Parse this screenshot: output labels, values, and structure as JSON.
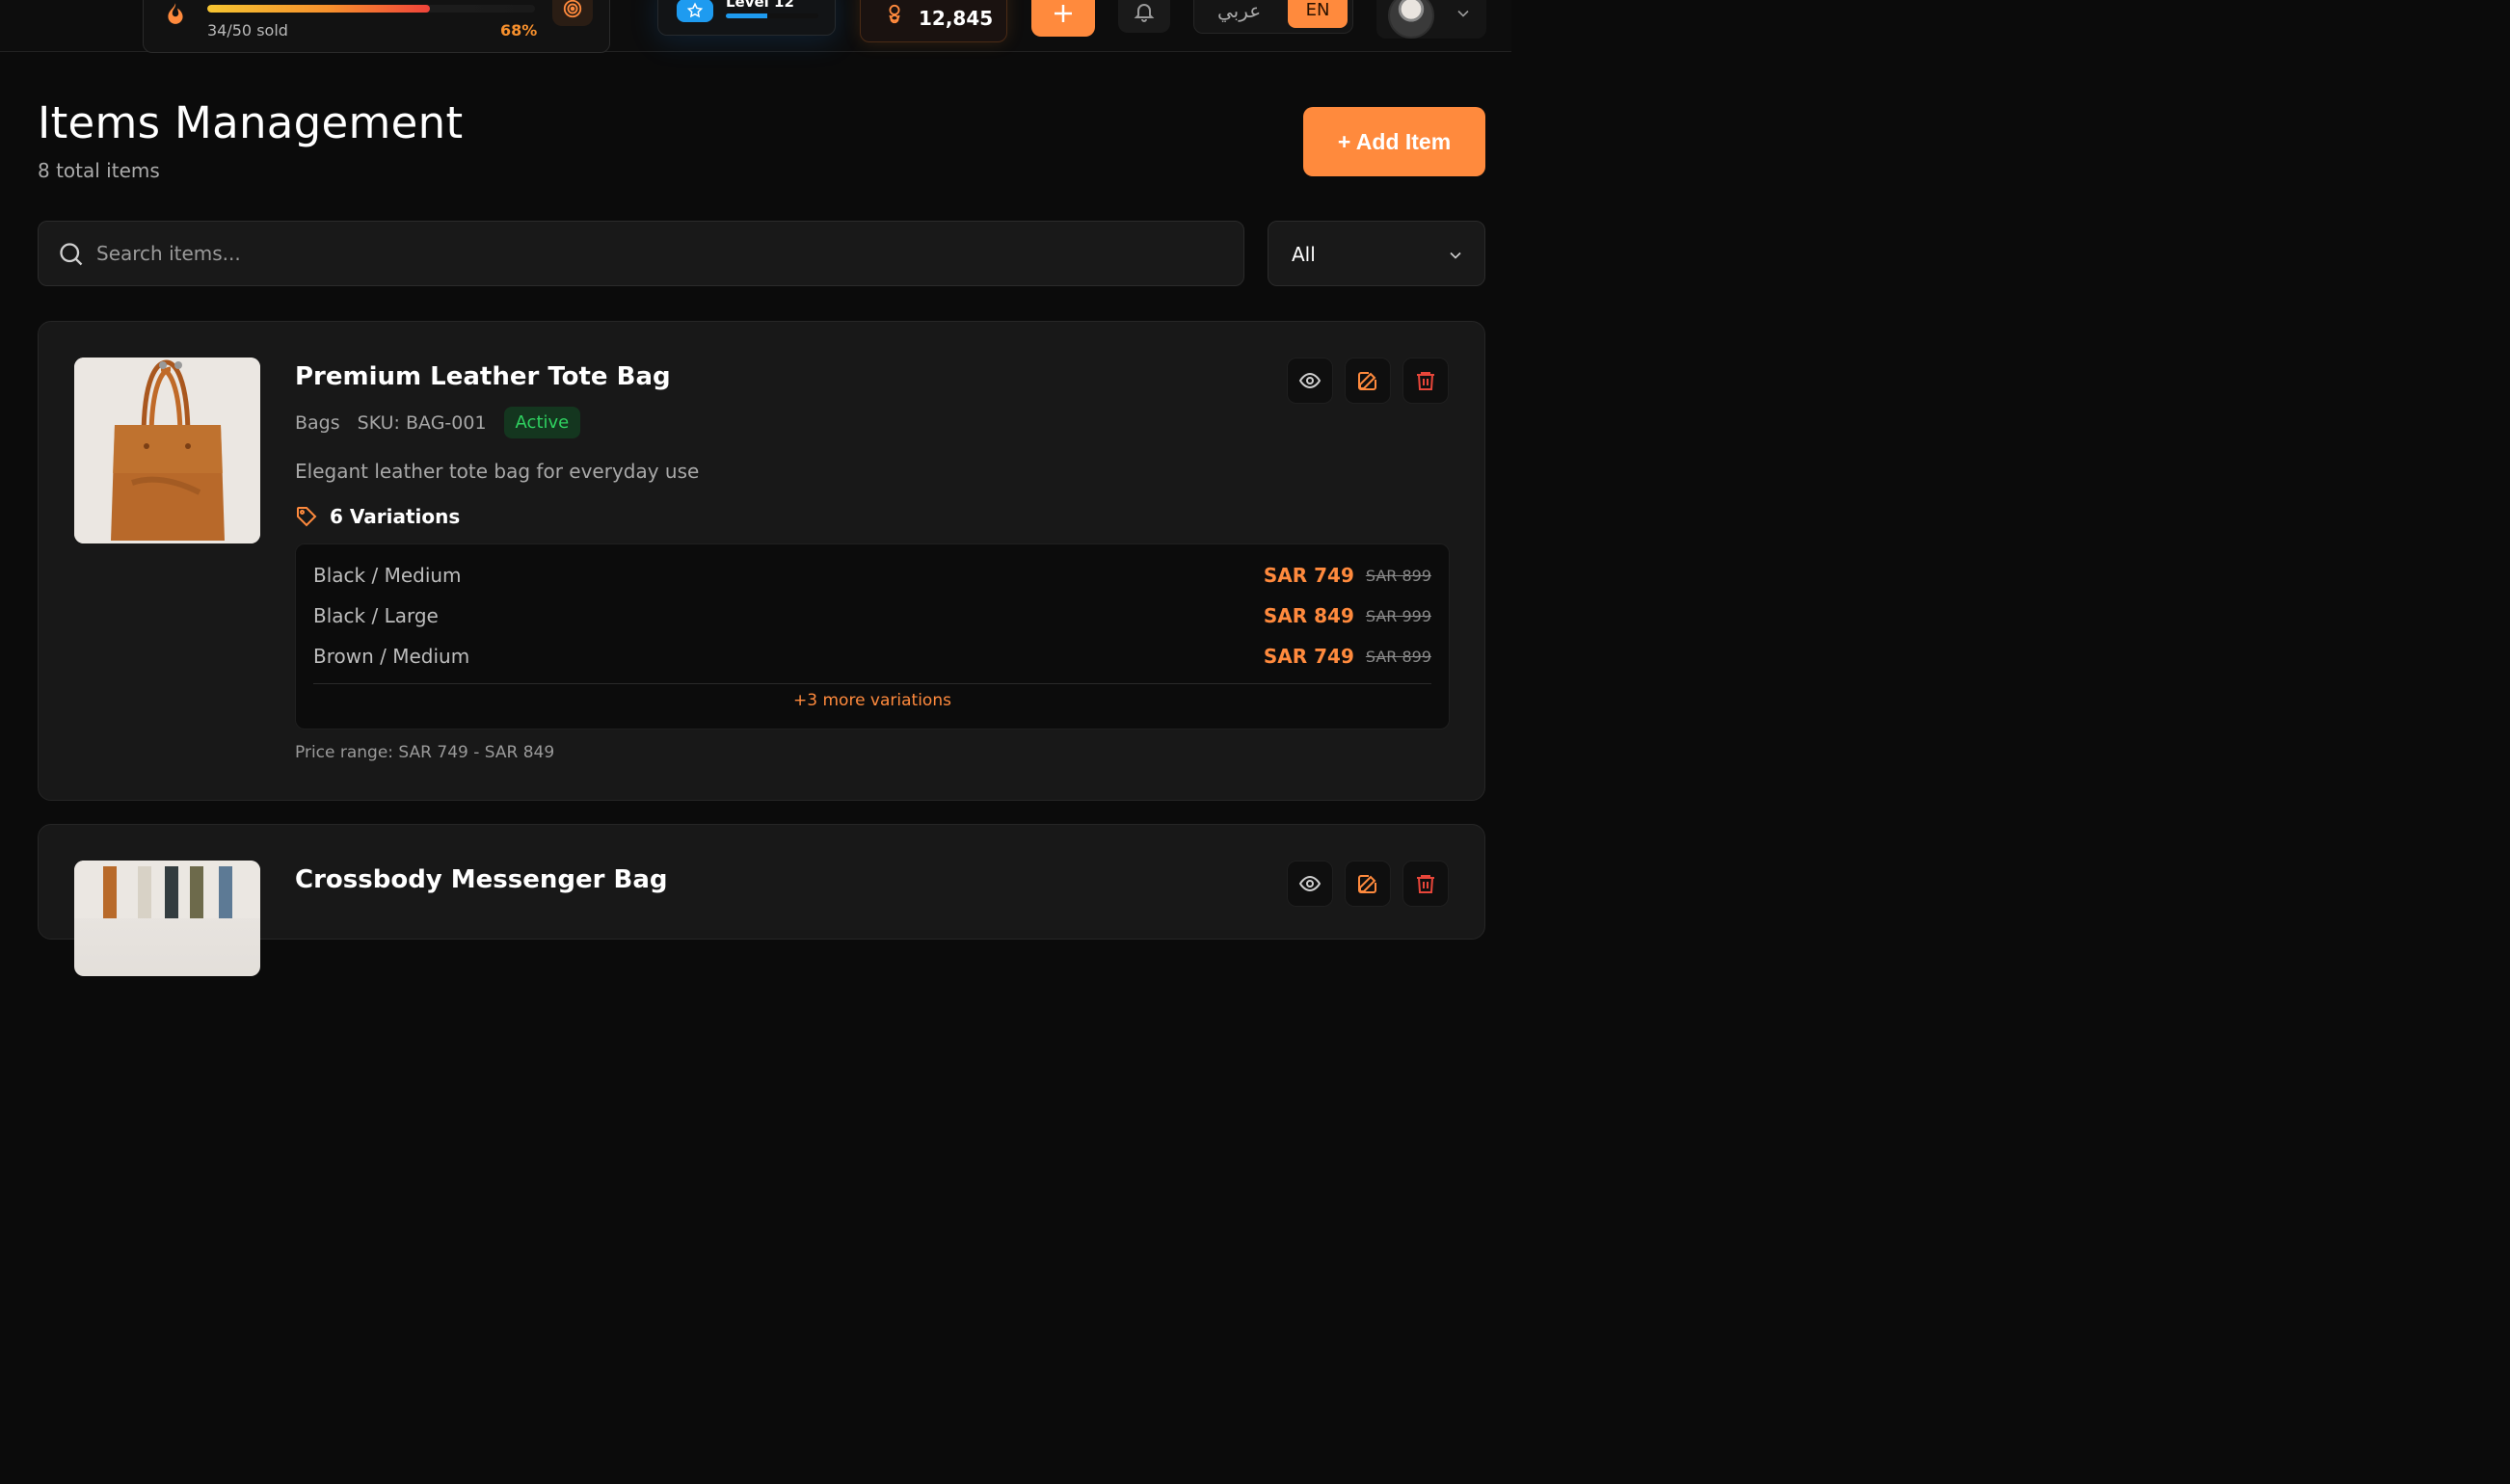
{
  "header": {
    "sales": {
      "sold_text": "34/50 sold",
      "percent_text": "68%",
      "progress": 0.68
    },
    "level": {
      "label": "Level 12",
      "progress": 0.45
    },
    "points": {
      "value": "12,845"
    },
    "language": {
      "arabic": "عربي",
      "english": "EN",
      "selected": "EN"
    }
  },
  "page": {
    "title": "Items Management",
    "subtitle": "8 total items",
    "add_button": "+ Add Item"
  },
  "search": {
    "placeholder": "Search items...",
    "value": ""
  },
  "filter": {
    "selected": "All"
  },
  "items": [
    {
      "name": "Premium Leather Tote Bag",
      "category": "Bags",
      "sku": "SKU: BAG-001",
      "status": "Active",
      "description": "Elegant leather tote bag for everyday use",
      "variations_label": "6 Variations",
      "variations": [
        {
          "name": "Black / Medium",
          "price": "SAR 749",
          "old_price": "SAR 899"
        },
        {
          "name": "Black / Large",
          "price": "SAR 849",
          "old_price": "SAR 999"
        },
        {
          "name": "Brown / Medium",
          "price": "SAR 749",
          "old_price": "SAR 899"
        }
      ],
      "more_variations": "+3 more variations",
      "price_range": "Price range: SAR 749 - SAR 849"
    },
    {
      "name": "Crossbody Messenger Bag"
    }
  ],
  "colors": {
    "accent": "#ff8a3d",
    "background": "#0b0b0b",
    "card": "#181818",
    "active_badge_bg": "#14361f",
    "active_badge_text": "#2fd160",
    "delete_red": "#e8463a",
    "level_blue": "#1e9bf0"
  },
  "icons": {
    "sales": "flame-icon",
    "target": "target-icon",
    "level": "star-icon",
    "points": "coins-icon",
    "add": "plus-icon",
    "notifications": "bell-icon",
    "profile_menu": "chevron-down-icon",
    "search": "search-icon",
    "filter": "chevron-down-icon",
    "view": "eye-icon",
    "edit": "edit-icon",
    "delete": "trash-icon",
    "variations": "tag-icon"
  }
}
